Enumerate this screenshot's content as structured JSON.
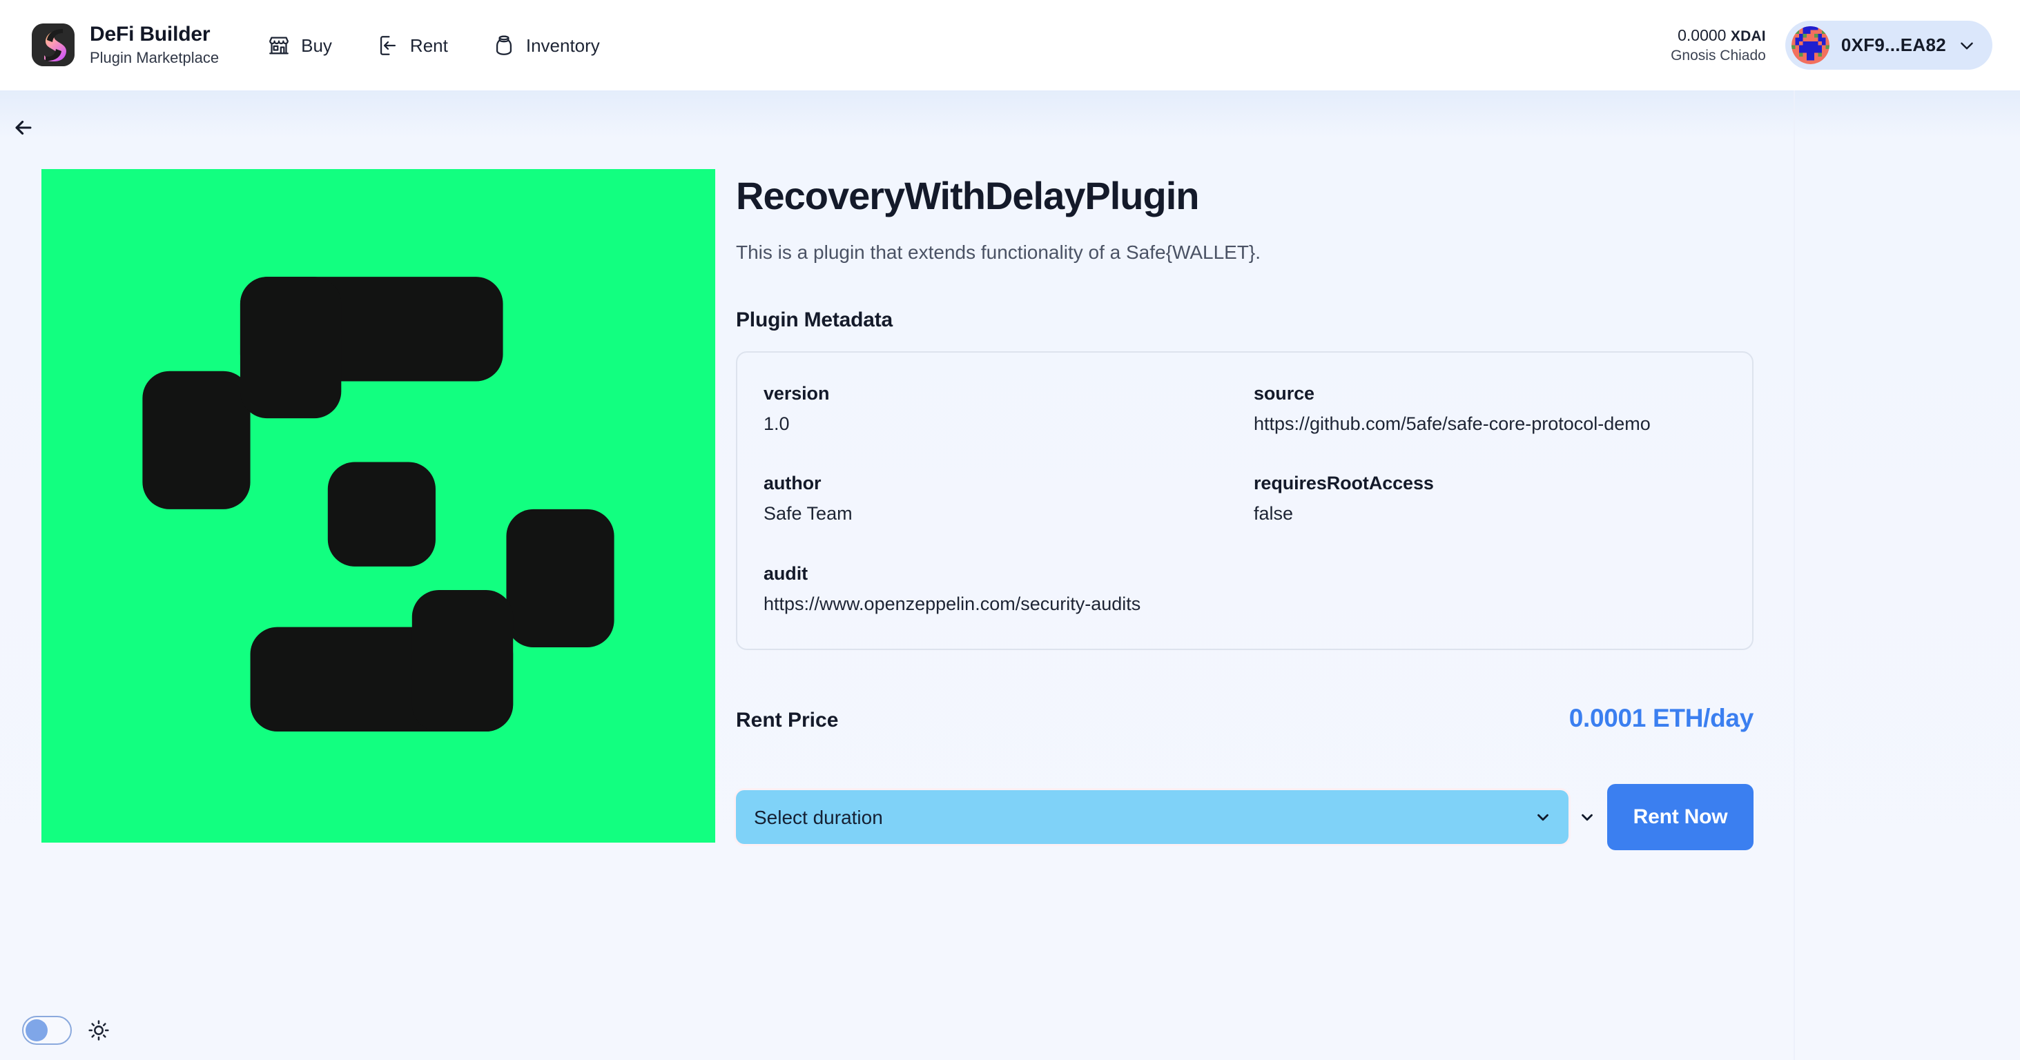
{
  "header": {
    "brand": {
      "logo_icon": "defi-builder-logo-icon",
      "title": "DeFi Builder",
      "subtitle": "Plugin Marketplace"
    },
    "nav": [
      {
        "icon": "storefront-icon",
        "label": "Buy"
      },
      {
        "icon": "sign-in-icon",
        "label": "Rent"
      },
      {
        "icon": "jar-icon",
        "label": "Inventory"
      }
    ],
    "wallet": {
      "balance": "0.0000",
      "balance_symbol": "XDAI",
      "network": "Gnosis Chiado",
      "avatar_icon": "identicon-avatar",
      "address": "0XF9...EA82",
      "chevron_icon": "chevron-down-icon"
    }
  },
  "back_button": {
    "icon": "arrow-left-icon",
    "label": ""
  },
  "plugin": {
    "image_icon": "safe-logo-image",
    "image_background": "#12FF80",
    "title": "RecoveryWithDelayPlugin",
    "description": "This is a plugin that extends functionality of a Safe{WALLET}.",
    "metadata_heading": "Plugin Metadata",
    "metadata": {
      "left": [
        {
          "key": "version",
          "value": "1.0"
        },
        {
          "key": "author",
          "value": "Safe Team"
        },
        {
          "key": "audit",
          "value": "https://www.openzeppelin.com/security-audits"
        }
      ],
      "right": [
        {
          "key": "source",
          "value": "https://github.com/5afe/safe-core-protocol-demo"
        },
        {
          "key": "requiresRootAccess",
          "value": "false"
        }
      ]
    }
  },
  "rent": {
    "price_label": "Rent Price",
    "price_value": "0.0001 ETH/day",
    "price_color": "#3B7FF0",
    "duration_placeholder": "Select duration",
    "duration_selected": "Select duration",
    "duration_options": [
      "Select duration"
    ],
    "select_chevron_icon": "chevron-down-icon",
    "outer_chevron_icon": "chevron-down-icon",
    "button_label": "Rent Now",
    "button_color": "#3B7FF0"
  },
  "theme": {
    "toggle_state": "off",
    "sun_icon": "sun-icon"
  }
}
